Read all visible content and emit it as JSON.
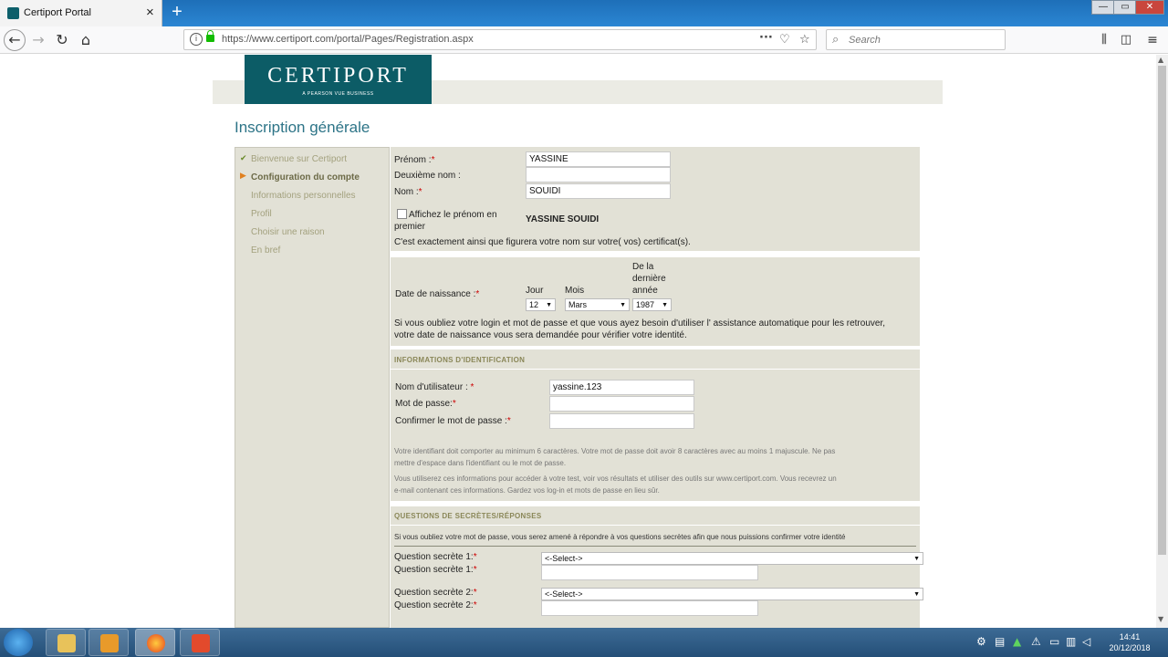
{
  "browser": {
    "tab_title": "Certiport Portal",
    "tab_close": "×",
    "new_tab": "+",
    "url_host": "https://www.certiport.com",
    "url_path": "/portal/Pages/Registration.aspx",
    "search_placeholder": "Search"
  },
  "window_controls": {
    "minimize": "—",
    "maximize": "▭",
    "close": "✕"
  },
  "logo": {
    "word": "CERTIPORT",
    "tagline": "A PEARSON VUE BUSINESS"
  },
  "page_title": "Inscription générale",
  "sidebar": {
    "items": [
      {
        "label": "Bienvenue sur Certiport"
      },
      {
        "label": "Configuration du compte"
      },
      {
        "label": "Informations personnelles"
      },
      {
        "label": "Profil"
      },
      {
        "label": "Choisir une raison"
      },
      {
        "label": "En bref"
      }
    ]
  },
  "name_section": {
    "prenom_label": "Prénom :",
    "prenom_value": "YASSINE",
    "deuxieme_label": "Deuxième nom :",
    "deuxieme_value": "",
    "nom_label": "Nom :",
    "nom_value": "SOUIDI",
    "checkbox_label_1": "Affichez le prénom en",
    "checkbox_label_2": "premier",
    "preview_name": "YASSINE SOUIDI",
    "certificate_note": "C'est exactement ainsi que figurera votre nom sur votre( vos) certificat(s).",
    "required_mark": "*"
  },
  "birth_section": {
    "label": "Date de naissance :",
    "day_header": "Jour",
    "month_header": "Mois",
    "year_header_1": "De la",
    "year_header_2": "dernière",
    "year_header_3": "année",
    "day_value": "12",
    "month_value": "Mars",
    "year_value": "1987",
    "note_1": "Si vous oubliez votre login et mot de passe et que vous ayez besoin d'utiliser l' assistance automatique pour les retrouver,",
    "note_2": "votre date de naissance vous sera demandée pour vérifier votre identité."
  },
  "identification": {
    "heading": "INFORMATIONS D'IDENTIFICATION",
    "username_label": "Nom d'utilisateur :",
    "username_value": "yassine.123",
    "password_label": "Mot de passe:",
    "confirm_label": "Confirmer le mot de passe :",
    "help_1a": "Votre identifiant doit comporter au minimum 6 caractères. Votre mot de passe doit avoir 8 caractères avec au moins 1 majuscule. Ne pas",
    "help_1b": "mettre d'espace dans l'identifiant ou le mot de passe.",
    "help_2a": "Vous utiliserez ces informations pour accéder à votre test, voir vos résultats et utiliser des outils sur www.certiport.com. Vous recevrez un",
    "help_2b": "e-mail contenant ces informations. Gardez vos log-in et mots de passe en lieu sûr."
  },
  "secret_questions": {
    "heading": "QUESTIONS DE SECRÈTES/RÉPONSES",
    "intro": "Si vous oubliez votre mot de passe, vous serez amené à répondre à vos questions secrètes afin que nous puissions confirmer votre identité",
    "q1_label": "Question secrète 1:",
    "a1_label": "Question secrète 1:",
    "q2_label": "Question secrète 2:",
    "a2_label": "Question secrète 2:",
    "select_placeholder": "<-Select->"
  },
  "taskbar": {
    "time": "14:41",
    "date": "20/12/2018"
  },
  "colors": {
    "accent_teal": "#0c5c66",
    "title_teal": "#2d7487",
    "panel_bg": "#e2e1d6",
    "required_red": "#cc0000",
    "sidebar_active_arrow": "#e08020"
  }
}
